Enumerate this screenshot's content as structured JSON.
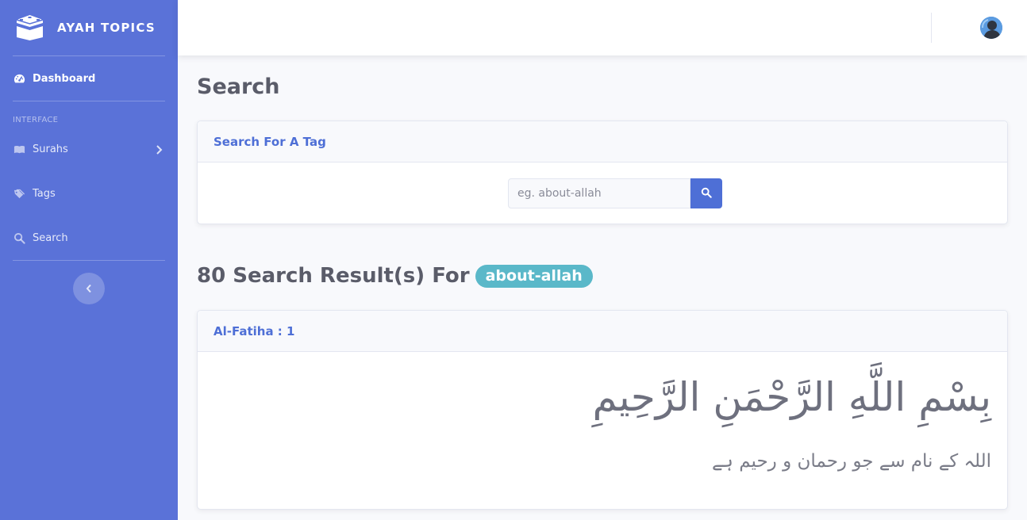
{
  "brand": {
    "name": "AYAH TOPICS",
    "icon": "kaaba-icon"
  },
  "sidebar": {
    "dashboard": {
      "label": "Dashboard",
      "icon": "tachometer-icon"
    },
    "heading": "INTERFACE",
    "items": [
      {
        "label": "Surahs",
        "icon": "book-icon"
      },
      {
        "label": "Tags",
        "icon": "tags-icon"
      },
      {
        "label": "Search",
        "icon": "search-icon"
      }
    ],
    "toggle_icon": "chevron-left-icon"
  },
  "topbar": {
    "avatar": "user-avatar"
  },
  "page": {
    "title": "Search"
  },
  "search_card": {
    "header": "Search For A Tag",
    "placeholder": "eg. about-allah",
    "value": "",
    "button_icon": "search-icon"
  },
  "results": {
    "title": "80 Search Result(s) For",
    "tag": "about-allah"
  },
  "ayah": {
    "reference": "Al-Fatiha : 1",
    "arabic": "بِسْمِ اللَّهِ الرَّحْمَنِ الرَّحِيمِ",
    "translation": "اللہ کے نام سے جو رحمان و رحیم ہے"
  },
  "colors": {
    "sidebar": "#5a72d8",
    "primary": "#4e6fd6",
    "badge": "#5ab8c9",
    "background": "#f8f9fc"
  }
}
